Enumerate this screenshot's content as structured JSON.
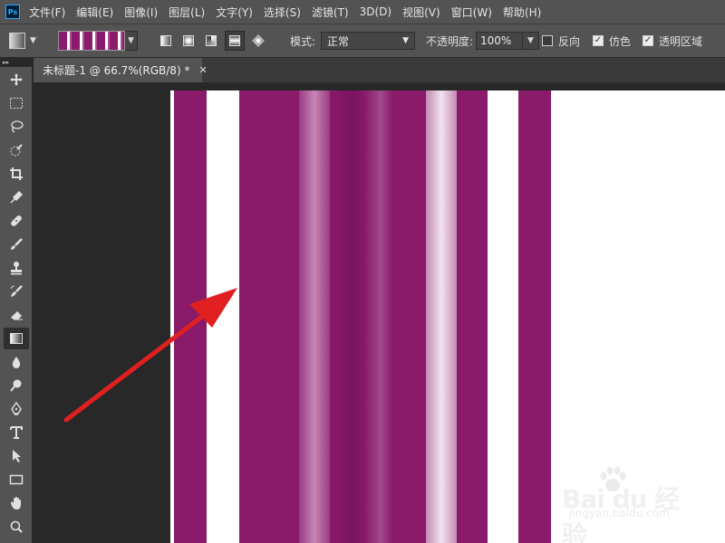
{
  "app": {
    "logo_text": "Ps"
  },
  "menu": {
    "items": [
      "文件(F)",
      "编辑(E)",
      "图像(I)",
      "图层(L)",
      "文字(Y)",
      "选择(S)",
      "滤镜(T)",
      "3D(D)",
      "视图(V)",
      "窗口(W)",
      "帮助(H)"
    ]
  },
  "options": {
    "mode_label": "模式:",
    "mode_value": "正常",
    "opacity_label": "不透明度:",
    "opacity_value": "100%",
    "reverse_label": "反向",
    "reverse_checked": false,
    "dither_label": "仿色",
    "dither_checked": true,
    "transparency_label": "透明区域",
    "transparency_checked": true,
    "gradient_types": [
      "linear",
      "radial",
      "angle",
      "reflected",
      "diamond"
    ],
    "active_gradient_type": "reflected"
  },
  "document": {
    "tab_title": "未标题-1 @ 66.7%(RGB/8) *",
    "colors": {
      "magenta": "#8a1a6a",
      "light": "#ffffff"
    }
  },
  "tools": [
    {
      "name": "move"
    },
    {
      "name": "marquee"
    },
    {
      "name": "lasso"
    },
    {
      "name": "quick-select"
    },
    {
      "name": "crop"
    },
    {
      "name": "eyedropper"
    },
    {
      "name": "healing"
    },
    {
      "name": "brush"
    },
    {
      "name": "stamp"
    },
    {
      "name": "history-brush"
    },
    {
      "name": "eraser"
    },
    {
      "name": "gradient",
      "active": true
    },
    {
      "name": "blur"
    },
    {
      "name": "dodge"
    },
    {
      "name": "pen"
    },
    {
      "name": "type"
    },
    {
      "name": "path-select"
    },
    {
      "name": "rectangle"
    },
    {
      "name": "hand"
    },
    {
      "name": "zoom"
    }
  ],
  "watermark": {
    "brand": "Bai du 经验",
    "url": "jingyan.baidu.com"
  }
}
